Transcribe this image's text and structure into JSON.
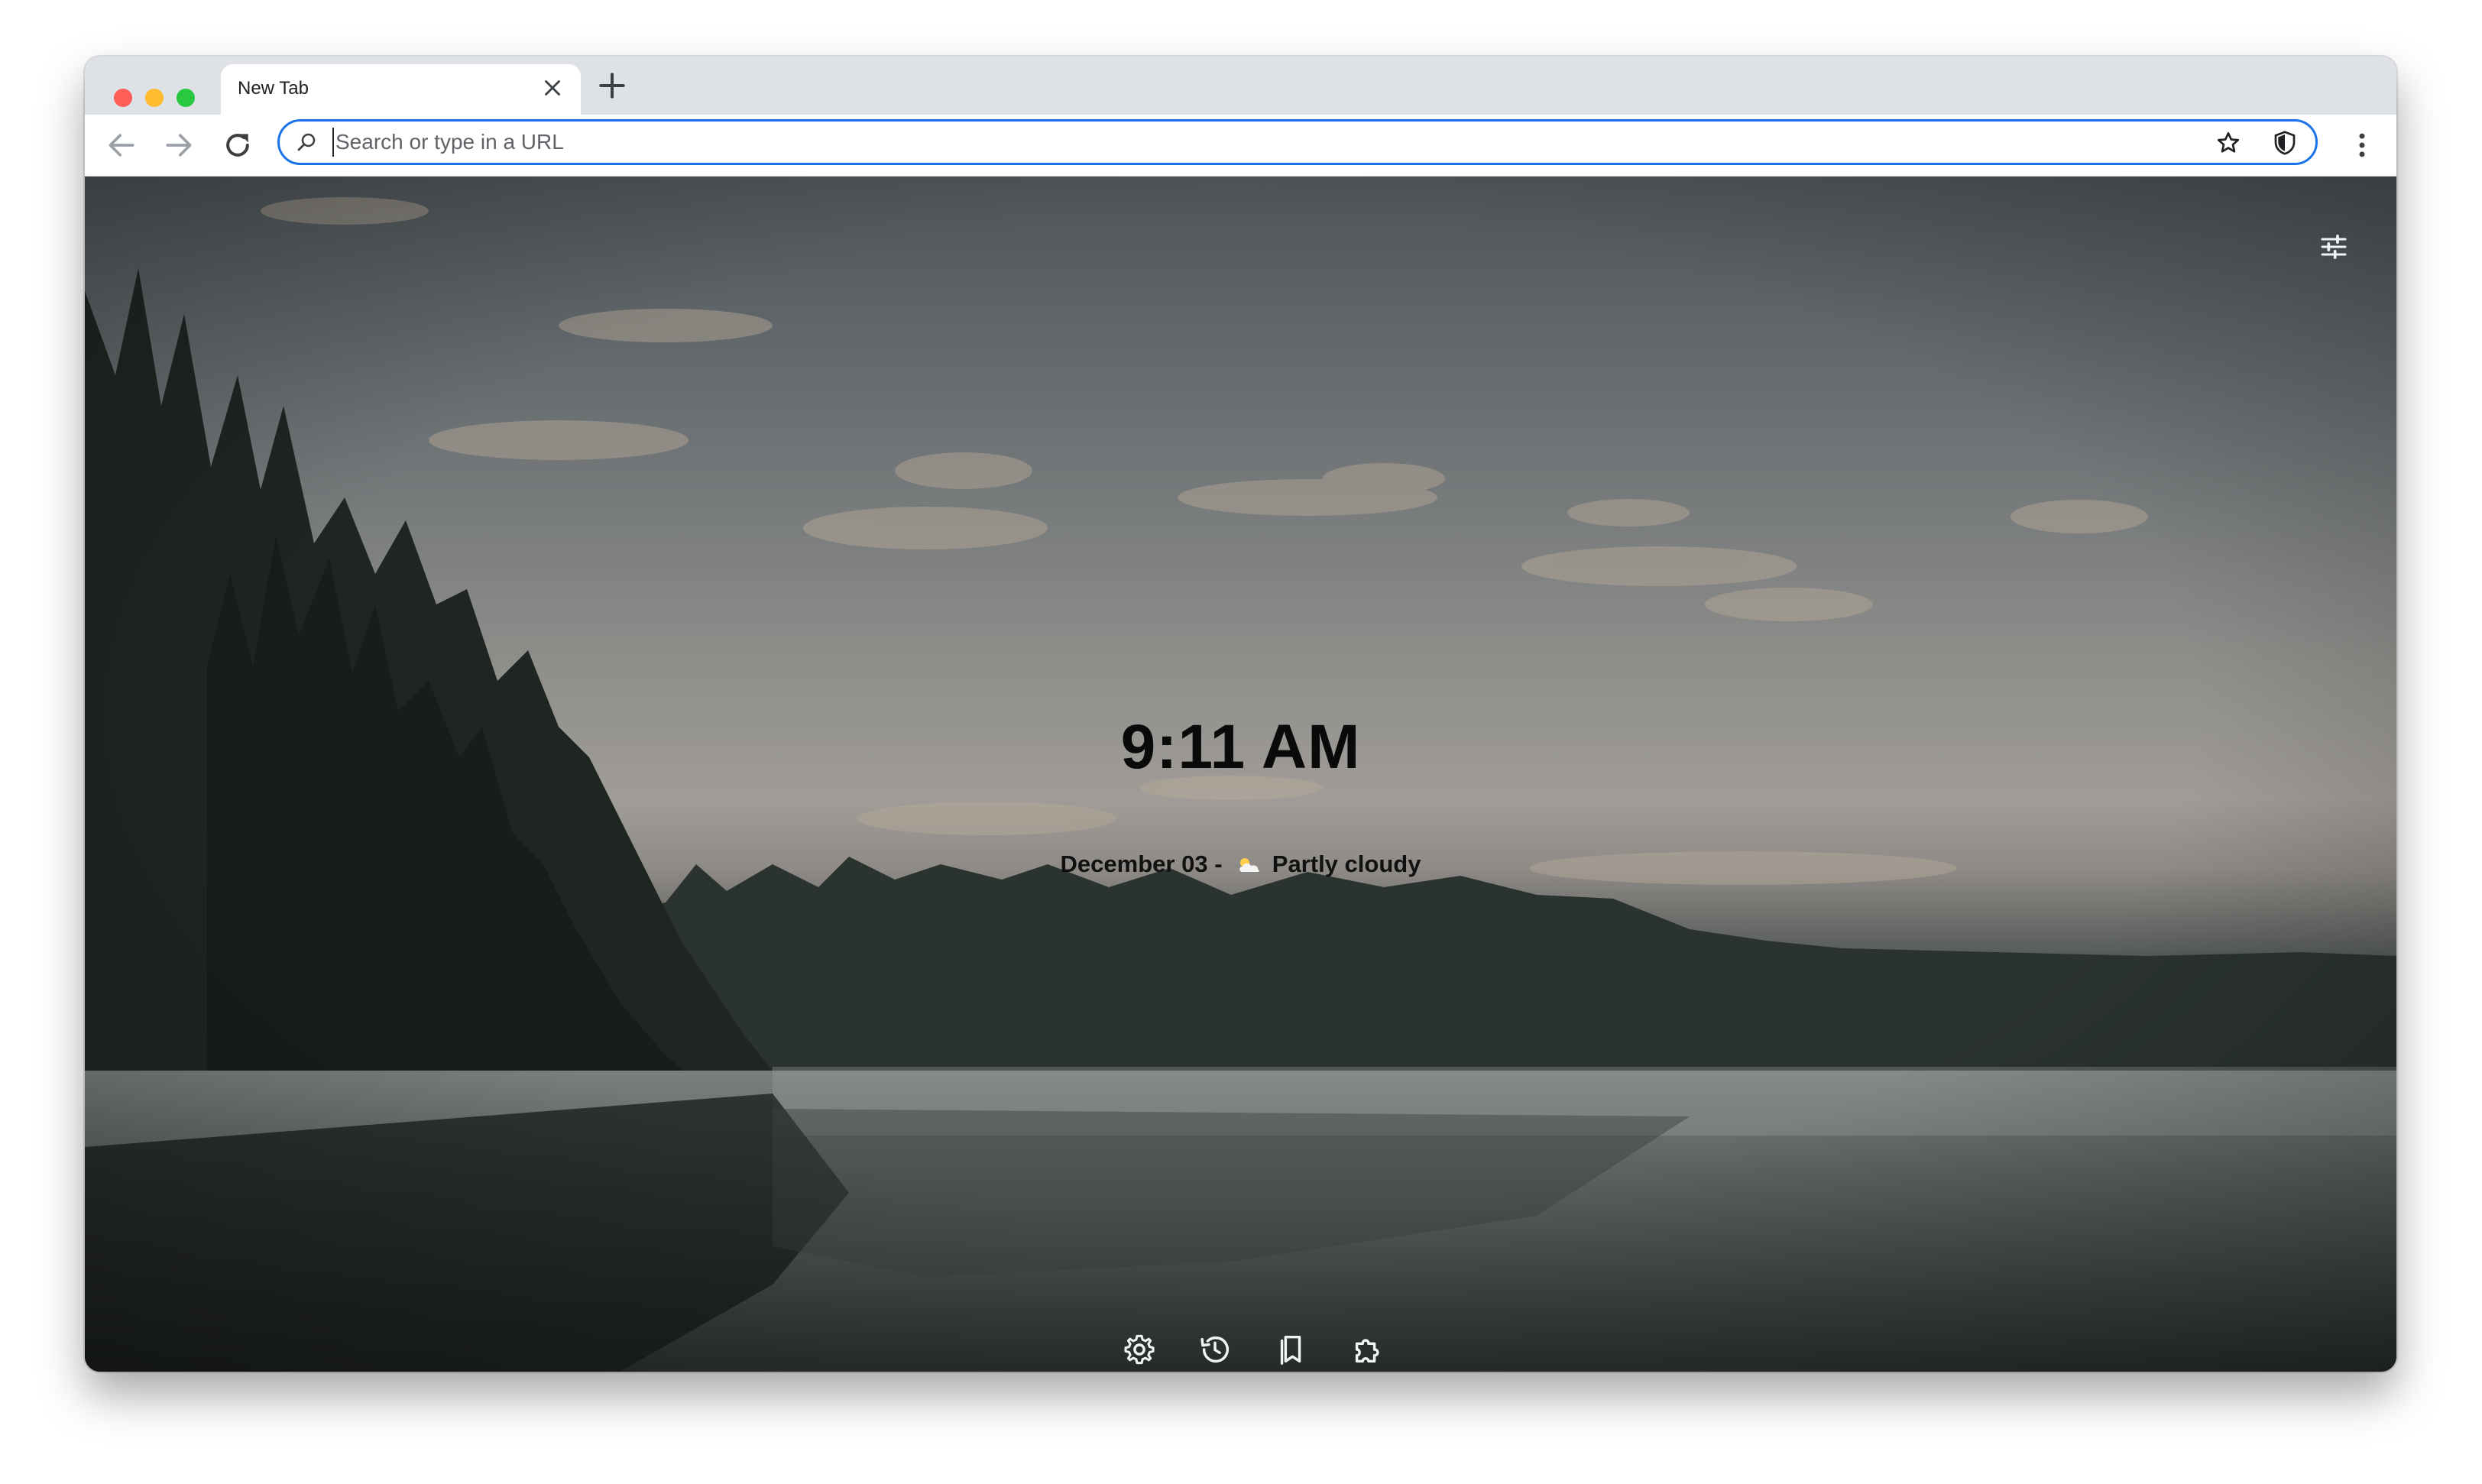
{
  "window": {
    "tab": {
      "title": "New Tab"
    }
  },
  "toolbar": {
    "omnibox_placeholder": "Search or type in a URL",
    "omnibox_value": ""
  },
  "new_tab_page": {
    "time": "9:11 AM",
    "date": "December 03",
    "separator": "-",
    "weather_icon": "partly-cloudy-icon",
    "weather": "Partly cloudy",
    "background": "misty lake at dusk with pine forest silhouette",
    "dock_icons": [
      "settings-gear-icon",
      "history-icon",
      "bookmarks-icon",
      "extensions-puzzle-icon"
    ],
    "customize_icon": "sliders-icon"
  },
  "colors": {
    "accent": "#1a73e8",
    "traffic_red": "#ff5f57",
    "traffic_yellow": "#febc2e",
    "traffic_green": "#28c840"
  }
}
